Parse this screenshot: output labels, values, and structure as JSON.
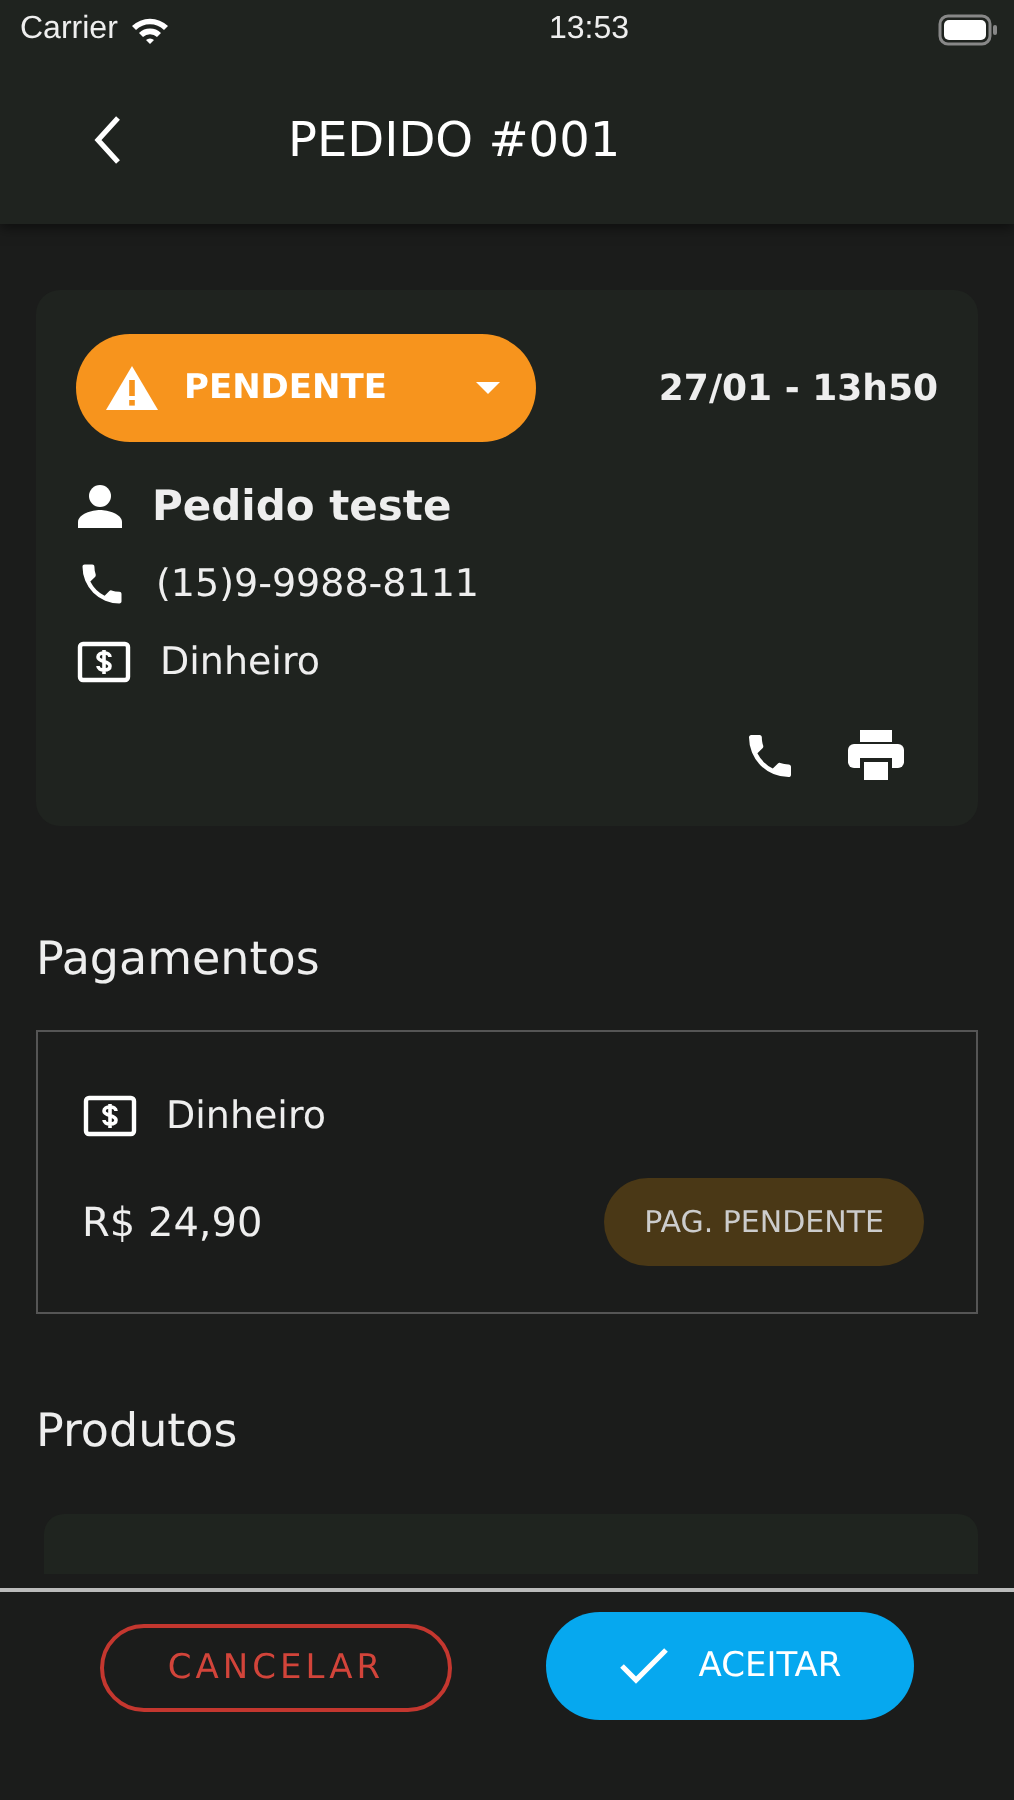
{
  "status_bar": {
    "carrier": "Carrier",
    "time": "13:53"
  },
  "header": {
    "title": "PEDIDO #001"
  },
  "order": {
    "status": "PENDENTE",
    "datetime": "27/01 - 13h50",
    "customer": "Pedido teste",
    "phone": "(15)9-9988-8111",
    "payment_method": "Dinheiro"
  },
  "payments": {
    "title": "Pagamentos",
    "items": [
      {
        "method": "Dinheiro",
        "amount": "R$ 24,90",
        "status": "PAG. PENDENTE"
      }
    ]
  },
  "products": {
    "title": "Produtos"
  },
  "footer": {
    "buttons": [
      {
        "kind": "outline",
        "label": "CANCELAR"
      },
      {
        "kind": "primary",
        "label": "ACEITAR"
      }
    ]
  }
}
